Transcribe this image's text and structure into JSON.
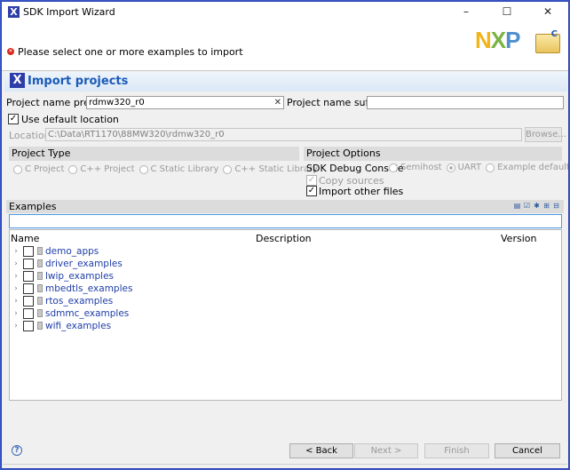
{
  "window": {
    "title": "SDK Import Wizard",
    "app_icon": "X",
    "controls": [
      "–",
      "☐",
      "✕"
    ]
  },
  "banner": {
    "message": "Please select one or more examples to import",
    "error_icon": "error-icon",
    "logo_text": {
      "n": "N",
      "x": "X",
      "p": "P"
    },
    "folder_badge": "C"
  },
  "section": {
    "title": "Import projects",
    "icon": "X"
  },
  "form": {
    "prefix_label": "Project name prefix:",
    "prefix_value": "rdmw320_r0",
    "suffix_label": "Project name suffix:",
    "suffix_value": "",
    "use_default_location_label": "Use default location",
    "use_default_location_checked": true,
    "location_label": "Location:",
    "location_value": "C:\\Data\\RT1170\\88MW320\\rdmw320_r0",
    "browse_label": "Browse..."
  },
  "project_type": {
    "title": "Project Type",
    "options": [
      "C Project",
      "C++ Project",
      "C Static Library",
      "C++ Static Library"
    ]
  },
  "project_options": {
    "title": "Project Options",
    "debug_console_label": "SDK Debug Console",
    "debug_options": [
      "Semihost",
      "UART",
      "Example default"
    ],
    "debug_selected": "UART",
    "copy_sources_label": "Copy sources",
    "copy_sources_checked": true,
    "import_other_label": "Import other files",
    "import_other_checked": true
  },
  "examples": {
    "title": "Examples",
    "filter_value": "",
    "columns": [
      "Name",
      "Description",
      "Version"
    ],
    "rows": [
      {
        "label": "demo_apps"
      },
      {
        "label": "driver_examples"
      },
      {
        "label": "lwip_examples"
      },
      {
        "label": "mbedtls_examples"
      },
      {
        "label": "rtos_examples"
      },
      {
        "label": "sdmmc_examples"
      },
      {
        "label": "wifi_examples"
      }
    ]
  },
  "footer": {
    "help": "?",
    "back_label": "< Back",
    "next_label": "Next >",
    "finish_label": "Finish",
    "cancel_label": "Cancel"
  }
}
